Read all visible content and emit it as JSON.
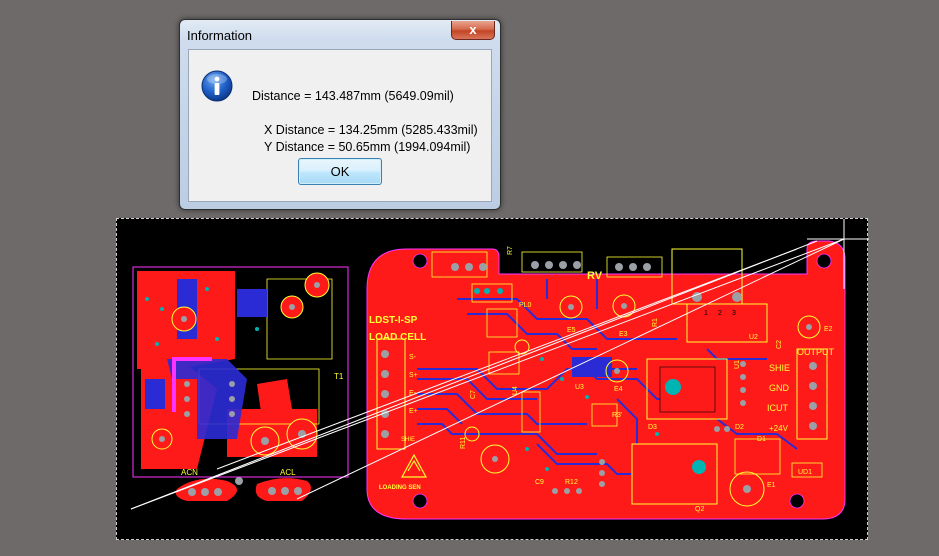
{
  "dialog": {
    "title": "Information",
    "close_glyph": "x",
    "icon": "info-icon",
    "distance": "Distance = 143.487mm (5649.09mil)",
    "x_distance": "X Distance = 134.25mm (5285.433mil)",
    "y_distance": "Y Distance = 50.65mm (1994.094mil)",
    "ok_label": "OK"
  },
  "pcb": {
    "labels": {
      "ldst": "LDST-I-SP",
      "load_cell": "LOAD CELL",
      "rv": "RV",
      "output": "OUTPUT",
      "shie": "SHIE",
      "gnd": "GND",
      "icut": "ICUT",
      "plus24v": "+24V",
      "brand": "LOADING SEN",
      "acn": "ACN",
      "acl": "ACL",
      "t1": "T1",
      "u1": "U1",
      "u2": "U2",
      "u3": "U3",
      "u4": "U4",
      "ud1": "UD1",
      "q2": "Q2",
      "e1": "E1",
      "e2": "E2",
      "e3": "E3",
      "e4": "E4",
      "e5": "E5",
      "d1": "D1",
      "d2": "D2",
      "d3": "D3",
      "r1": "R1",
      "r3": "R3'",
      "r7": "R7",
      "r11": "R11",
      "r12": "R12",
      "c9": "C9",
      "c7": "C7",
      "c2": "C2",
      "pl0": "PL0",
      "sig_minus": "S-",
      "sig_plus": "S+",
      "e_minus": "E-",
      "e_plus": "E+",
      "shie_side": "SHIE",
      "pin1": "1",
      "pin2": "2",
      "pin3": "3"
    },
    "colors": {
      "board": "#ff1a1a",
      "trace": "#2b2bd6",
      "silk": "#ffff33",
      "pad": "#9aa0a6",
      "via": "#00b4b4",
      "outline": "#ff33ff",
      "ruler": "#ffffff"
    }
  }
}
